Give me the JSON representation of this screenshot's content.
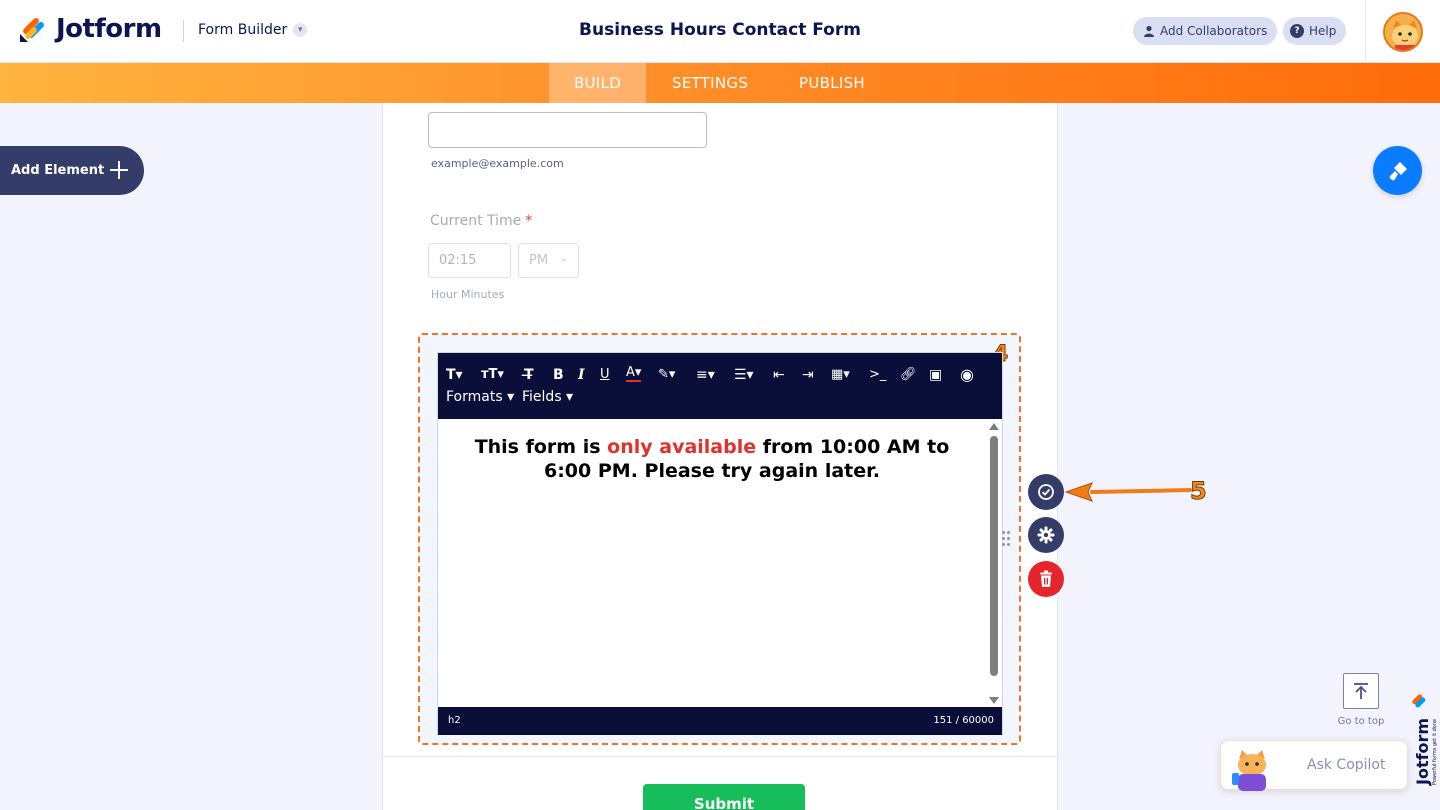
{
  "header": {
    "logo_text": "Jotform",
    "builder_label": "Form Builder",
    "form_title": "Business Hours Contact Form",
    "add_collaborators": "Add Collaborators",
    "help": "Help"
  },
  "nav": {
    "tabs": [
      "BUILD",
      "SETTINGS",
      "PUBLISH"
    ],
    "active_tab": "BUILD"
  },
  "left": {
    "add_element": "Add Element"
  },
  "form": {
    "email_sublabel": "example@example.com",
    "time_label": "Current Time",
    "time_required_mark": "*",
    "time_value": "02:15",
    "ampm_value": "PM",
    "time_sublabel": "Hour Minutes",
    "submit_label": "Submit"
  },
  "editor": {
    "toolbar_row2": [
      "Formats",
      "Fields"
    ],
    "content_part1": "This form is ",
    "content_highlight": "only available",
    "content_part2": " from 10:00 AM to 6:00 PM. Please try again later.",
    "highlight_color": "#e2302a",
    "status_path": "h2",
    "char_count": "151 / 60000"
  },
  "annotations": {
    "badge_4": "4",
    "badge_5": "5"
  },
  "right": {
    "goto_top": "Go to top",
    "ask_copilot": "Ask Copilot"
  },
  "colors": {
    "accent_orange": "#ff6c0a",
    "navy": "#0a1551",
    "submit_green": "#18bd5b",
    "paint_blue": "#0a7cff"
  }
}
